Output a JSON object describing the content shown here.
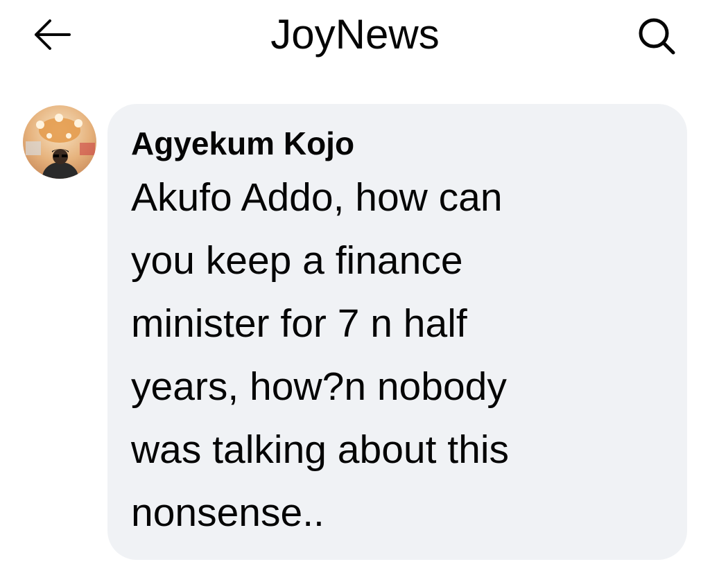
{
  "header": {
    "title": "JoyNews",
    "back_icon": "back-arrow-icon",
    "search_icon": "search-icon"
  },
  "comment": {
    "author": "Agyekum Kojo",
    "avatar_icon": "profile-avatar",
    "lines": [
      "Akufo Addo, how can",
      "you keep a finance",
      "minister for 7 n half",
      "years, how?n nobody",
      "was talking about this",
      "nonsense.."
    ]
  },
  "colors": {
    "bubble_bg": "#f0f2f5",
    "text": "#050505"
  }
}
